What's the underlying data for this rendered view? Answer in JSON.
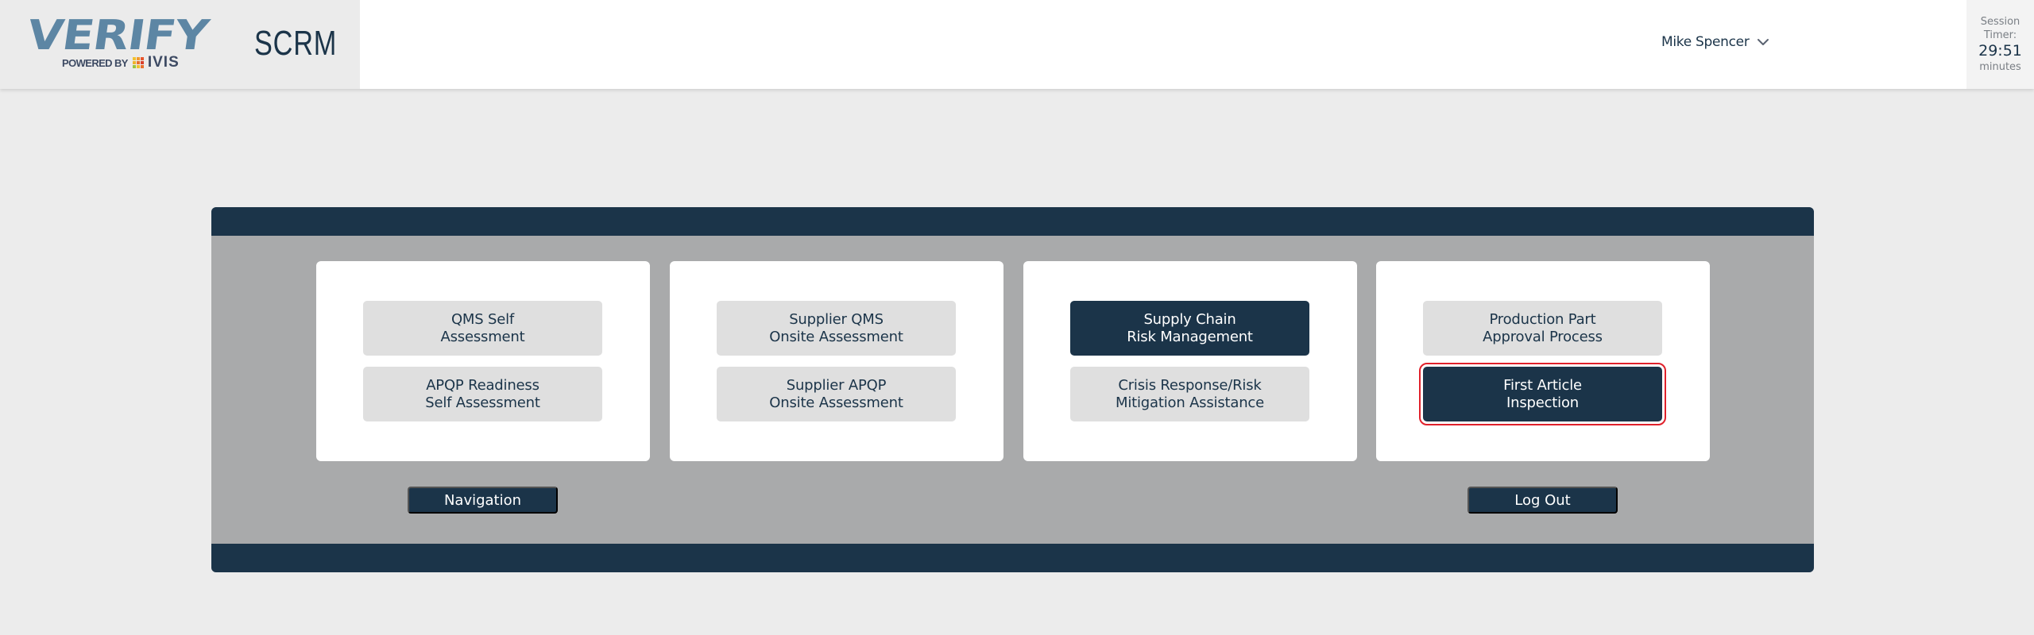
{
  "header": {
    "logo": {
      "brand": "VERIFY",
      "powered_by": "POWERED BY",
      "partner": "IVIS",
      "brand_color": "#5d86a4",
      "partner_grid_colors": [
        "#f2c230",
        "#f29a2e",
        "#e8562c",
        "#f0b32a",
        "#e8702c",
        "#d93f2b",
        "#9cc43f",
        "#f2c230",
        "#e8702c"
      ]
    },
    "app_title": "SCRM",
    "user": {
      "name": "Mike Spencer",
      "menu_icon": "chevron-down-icon"
    },
    "session_timer": {
      "label_line1": "Session",
      "label_line2": "Timer:",
      "value": "29:51",
      "unit": "minutes"
    }
  },
  "modules": {
    "cards": [
      {
        "buttons": [
          {
            "label": "QMS Self\nAssessment",
            "style": "light"
          },
          {
            "label": "APQP Readiness\nSelf Assessment",
            "style": "light"
          }
        ]
      },
      {
        "buttons": [
          {
            "label": "Supplier QMS\nOnsite Assessment",
            "style": "light"
          },
          {
            "label": "Supplier APQP\nOnsite Assessment",
            "style": "light"
          }
        ]
      },
      {
        "buttons": [
          {
            "label": "Supply Chain\nRisk Management",
            "style": "dark"
          },
          {
            "label": "Crisis Response/Risk\nMitigation Assistance",
            "style": "light"
          }
        ]
      },
      {
        "buttons": [
          {
            "label": "Production Part\nApproval Process",
            "style": "light"
          },
          {
            "label": "First Article\nInspection",
            "style": "dark",
            "focused": true
          }
        ]
      }
    ],
    "navigation_label": "Navigation",
    "logout_label": "Log Out"
  },
  "colors": {
    "primary": "#1b3449",
    "panel_bg": "#a9aaab",
    "button_light": "#dfdfdf",
    "focus_outline": "#e0212b",
    "page_bg": "#ececec"
  }
}
